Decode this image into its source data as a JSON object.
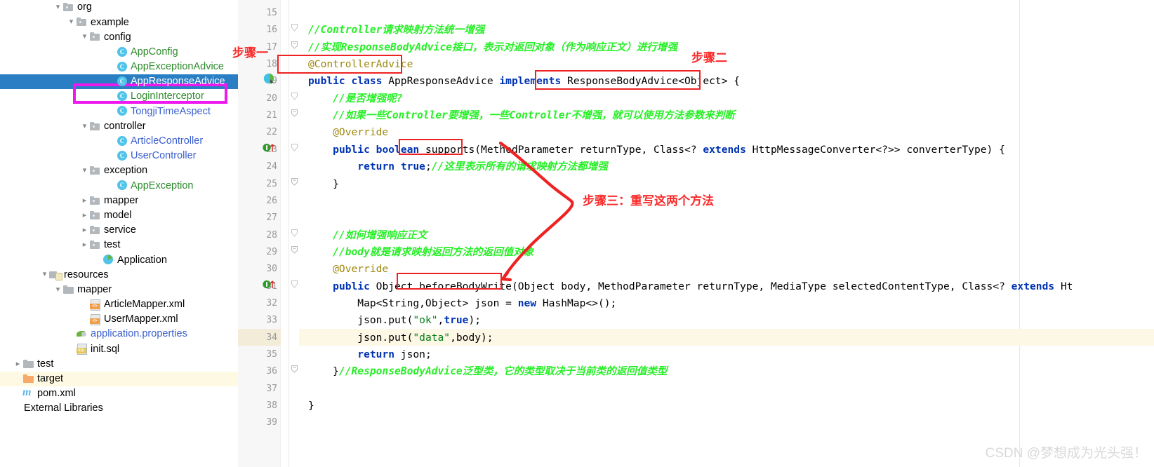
{
  "project_tree": {
    "rows": [
      {
        "indent": 4,
        "twisty": "v",
        "icon": "folder-icon",
        "label": "org",
        "color": "black",
        "selected": false,
        "highlight": false
      },
      {
        "indent": 5,
        "twisty": "v",
        "icon": "folder-icon",
        "label": "example",
        "color": "black",
        "selected": false,
        "highlight": false
      },
      {
        "indent": 6,
        "twisty": "v",
        "icon": "folder-icon",
        "label": "config",
        "color": "black",
        "selected": false,
        "highlight": false
      },
      {
        "indent": 8,
        "twisty": "",
        "icon": "java-class-icon",
        "label": "AppConfig",
        "color": "green",
        "selected": false,
        "highlight": false
      },
      {
        "indent": 8,
        "twisty": "",
        "icon": "java-class-icon",
        "label": "AppExceptionAdvice",
        "color": "green",
        "selected": false,
        "highlight": false
      },
      {
        "indent": 8,
        "twisty": "",
        "icon": "java-class-icon",
        "label": "AppResponseAdvice",
        "color": "green",
        "selected": true,
        "highlight": false
      },
      {
        "indent": 8,
        "twisty": "",
        "icon": "java-class-icon",
        "label": "LoginInterceptor",
        "color": "green",
        "selected": false,
        "highlight": false
      },
      {
        "indent": 8,
        "twisty": "",
        "icon": "java-class-icon",
        "label": "TongjiTimeAspect",
        "color": "blue",
        "selected": false,
        "highlight": false
      },
      {
        "indent": 6,
        "twisty": "v",
        "icon": "folder-icon",
        "label": "controller",
        "color": "black",
        "selected": false,
        "highlight": false
      },
      {
        "indent": 8,
        "twisty": "",
        "icon": "java-class-icon",
        "label": "ArticleController",
        "color": "blue",
        "selected": false,
        "highlight": false
      },
      {
        "indent": 8,
        "twisty": "",
        "icon": "java-class-icon",
        "label": "UserController",
        "color": "blue",
        "selected": false,
        "highlight": false
      },
      {
        "indent": 6,
        "twisty": "v",
        "icon": "folder-icon",
        "label": "exception",
        "color": "black",
        "selected": false,
        "highlight": false
      },
      {
        "indent": 8,
        "twisty": "",
        "icon": "java-class-icon",
        "label": "AppException",
        "color": "green",
        "selected": false,
        "highlight": false
      },
      {
        "indent": 6,
        "twisty": ">",
        "icon": "folder-icon",
        "label": "mapper",
        "color": "black",
        "selected": false,
        "highlight": false
      },
      {
        "indent": 6,
        "twisty": ">",
        "icon": "folder-icon",
        "label": "model",
        "color": "black",
        "selected": false,
        "highlight": false
      },
      {
        "indent": 6,
        "twisty": ">",
        "icon": "folder-icon",
        "label": "service",
        "color": "black",
        "selected": false,
        "highlight": false
      },
      {
        "indent": 6,
        "twisty": ">",
        "icon": "folder-icon",
        "label": "test",
        "color": "black",
        "selected": false,
        "highlight": false
      },
      {
        "indent": 7,
        "twisty": "",
        "icon": "spring-app-icon",
        "label": "Application",
        "color": "black",
        "selected": false,
        "highlight": false
      },
      {
        "indent": 3,
        "twisty": "v",
        "icon": "resources-folder-icon",
        "label": "resources",
        "color": "black",
        "selected": false,
        "highlight": false
      },
      {
        "indent": 4,
        "twisty": "v",
        "icon": "plain-folder-icon",
        "label": "mapper",
        "color": "black",
        "selected": false,
        "highlight": false
      },
      {
        "indent": 6,
        "twisty": "",
        "icon": "xml-file-icon",
        "label": "ArticleMapper.xml",
        "color": "black",
        "selected": false,
        "highlight": false
      },
      {
        "indent": 6,
        "twisty": "",
        "icon": "xml-file-icon",
        "label": "UserMapper.xml",
        "color": "black",
        "selected": false,
        "highlight": false
      },
      {
        "indent": 5,
        "twisty": "",
        "icon": "properties-file-icon",
        "label": "application.properties",
        "color": "blue",
        "selected": false,
        "highlight": false
      },
      {
        "indent": 5,
        "twisty": "",
        "icon": "sql-file-icon",
        "label": "init.sql",
        "color": "black",
        "selected": false,
        "highlight": false
      },
      {
        "indent": 1,
        "twisty": ">",
        "icon": "plain-folder-icon",
        "label": "test",
        "color": "black",
        "selected": false,
        "highlight": false
      },
      {
        "indent": 1,
        "twisty": "",
        "icon": "orange-folder-icon",
        "label": "target",
        "color": "black",
        "selected": false,
        "highlight": true
      },
      {
        "indent": 1,
        "twisty": "",
        "icon": "maven-file-icon",
        "label": "pom.xml",
        "color": "black",
        "selected": false,
        "highlight": false
      },
      {
        "indent": 0,
        "twisty": "",
        "icon": "",
        "label": "External Libraries",
        "color": "black",
        "selected": false,
        "highlight": false
      }
    ]
  },
  "editor": {
    "highlighted_line": 34,
    "lines": [
      {
        "no": "15",
        "segments": []
      },
      {
        "no": "16",
        "fold": "collapse",
        "segments": [
          {
            "t": "//Controller请求映射方法统一增强",
            "c": "cmt"
          }
        ]
      },
      {
        "no": "17",
        "fold": "minus",
        "segments": [
          {
            "t": "//实现ResponseBodyAdvice接口，表示对返回对象（作为响应正文）进行增强",
            "c": "cmt"
          }
        ]
      },
      {
        "no": "18",
        "segments": [
          {
            "t": "@ControllerAdvice",
            "c": "ann"
          }
        ]
      },
      {
        "no": "19",
        "gutter": "spring-bean-icon",
        "segments": [
          {
            "t": "public",
            "c": "kw"
          },
          {
            "t": " ",
            "c": ""
          },
          {
            "t": "class",
            "c": "kw"
          },
          {
            "t": " AppResponseAdvice ",
            "c": ""
          },
          {
            "t": "implements",
            "c": "kw"
          },
          {
            "t": " ResponseBodyAdvice<Object> {",
            "c": ""
          }
        ]
      },
      {
        "no": "20",
        "fold": "collapse",
        "segments": [
          {
            "t": "    //是否增强呢?",
            "c": "cmt"
          }
        ]
      },
      {
        "no": "21",
        "fold": "minus",
        "segments": [
          {
            "t": "    //如果一些Controller要增强，一些Controller不增强，就可以使用方法参数来判断",
            "c": "cmt"
          }
        ]
      },
      {
        "no": "22",
        "segments": [
          {
            "t": "    @Override",
            "c": "ann"
          }
        ]
      },
      {
        "no": "23",
        "gutter": "override-icon",
        "fold": "collapse",
        "segments": [
          {
            "t": "    ",
            "c": ""
          },
          {
            "t": "public",
            "c": "kw"
          },
          {
            "t": " ",
            "c": ""
          },
          {
            "t": "boolean",
            "c": "kw"
          },
          {
            "t": " supports(MethodParameter returnType, Class<? ",
            "c": ""
          },
          {
            "t": "extends",
            "c": "kw"
          },
          {
            "t": " HttpMessageConverter<?>> converterType) {",
            "c": ""
          }
        ]
      },
      {
        "no": "24",
        "segments": [
          {
            "t": "        ",
            "c": ""
          },
          {
            "t": "return",
            "c": "kw"
          },
          {
            "t": " ",
            "c": ""
          },
          {
            "t": "true",
            "c": "kw"
          },
          {
            "t": ";",
            "c": ""
          },
          {
            "t": "//这里表示所有的请求映射方法都增强",
            "c": "cmt"
          }
        ]
      },
      {
        "no": "25",
        "fold": "minus",
        "segments": [
          {
            "t": "    }",
            "c": ""
          }
        ]
      },
      {
        "no": "26",
        "segments": []
      },
      {
        "no": "27",
        "segments": []
      },
      {
        "no": "28",
        "fold": "collapse",
        "segments": [
          {
            "t": "    //如何增强响应正文",
            "c": "cmt"
          }
        ]
      },
      {
        "no": "29",
        "fold": "minus",
        "segments": [
          {
            "t": "    //body就是请求映射返回方法的返回值对象",
            "c": "cmt"
          }
        ]
      },
      {
        "no": "30",
        "segments": [
          {
            "t": "    @Override",
            "c": "ann"
          }
        ]
      },
      {
        "no": "31",
        "gutter": "override-icon",
        "fold": "collapse",
        "segments": [
          {
            "t": "    ",
            "c": ""
          },
          {
            "t": "public",
            "c": "kw"
          },
          {
            "t": " Object beforeBodyWrite(Object body, MethodParameter returnType, MediaType selectedContentType, Class<? ",
            "c": ""
          },
          {
            "t": "extends",
            "c": "kw"
          },
          {
            "t": " Ht",
            "c": ""
          }
        ]
      },
      {
        "no": "32",
        "segments": [
          {
            "t": "        Map<String,Object> json = ",
            "c": ""
          },
          {
            "t": "new",
            "c": "kw"
          },
          {
            "t": " HashMap<>();",
            "c": ""
          }
        ]
      },
      {
        "no": "33",
        "segments": [
          {
            "t": "        json.put(",
            "c": ""
          },
          {
            "t": "\"ok\"",
            "c": "str"
          },
          {
            "t": ",",
            "c": ""
          },
          {
            "t": "true",
            "c": "kw"
          },
          {
            "t": ");",
            "c": ""
          }
        ]
      },
      {
        "no": "34",
        "segments": [
          {
            "t": "        json.put(",
            "c": ""
          },
          {
            "t": "\"data\"",
            "c": "str"
          },
          {
            "t": ",body);",
            "c": ""
          }
        ]
      },
      {
        "no": "35",
        "segments": [
          {
            "t": "        ",
            "c": ""
          },
          {
            "t": "return",
            "c": "kw"
          },
          {
            "t": " json;",
            "c": ""
          }
        ]
      },
      {
        "no": "36",
        "fold": "minus",
        "segments": [
          {
            "t": "    }",
            "c": ""
          },
          {
            "t": "//ResponseBodyAdvice泛型类，它的类型取决于当前类的返回值类型",
            "c": "cmt"
          }
        ]
      },
      {
        "no": "37",
        "segments": []
      },
      {
        "no": "38",
        "segments": [
          {
            "t": "}",
            "c": ""
          }
        ]
      },
      {
        "no": "39",
        "segments": []
      }
    ]
  },
  "annotations": {
    "step_one_label": "步骤一",
    "step_two_label": "步骤二",
    "step_three_label": "步骤三：重写这两个方法",
    "red_color": "#ee2222",
    "magenta_color": "#ee19ee"
  },
  "watermark": "CSDN @梦想成为光头强！"
}
